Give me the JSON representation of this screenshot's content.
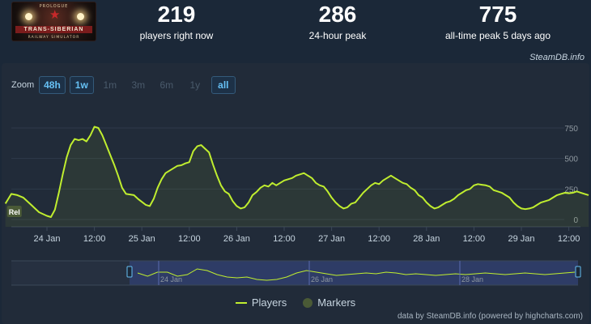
{
  "game": {
    "thumb_small": "PROLOGUE",
    "thumb_title": "TRANS-SIBERIAN",
    "thumb_sub": "RAILWAY SIMULATOR"
  },
  "stats": [
    {
      "value": "219",
      "label": "players right now"
    },
    {
      "value": "286",
      "label": "24-hour peak"
    },
    {
      "value": "775",
      "label": "all-time peak 5 days ago"
    }
  ],
  "credit_top": "SteamDB.info",
  "zoom": {
    "label": "Zoom",
    "buttons": [
      {
        "label": "48h",
        "state": "active"
      },
      {
        "label": "1w",
        "state": "active"
      },
      {
        "label": "1m",
        "state": "dim"
      },
      {
        "label": "3m",
        "state": "dim"
      },
      {
        "label": "6m",
        "state": "dim"
      },
      {
        "label": "1y",
        "state": "dim"
      },
      {
        "label": "all",
        "state": "active"
      }
    ]
  },
  "legend": {
    "players": "Players",
    "markers": "Markers"
  },
  "credit_bottom": "data by SteamDB.info (powered by highcharts.com)",
  "colors": {
    "line": "#c0ee2f",
    "marker": "#4a5a36",
    "navigator_fill": "#3a4a8c"
  },
  "chart_data": {
    "type": "line",
    "title": "",
    "xlabel": "",
    "ylabel": "",
    "x_tick_labels": [
      "24 Jan",
      "12:00",
      "25 Jan",
      "12:00",
      "26 Jan",
      "12:00",
      "27 Jan",
      "12:00",
      "28 Jan",
      "12:00",
      "29 Jan",
      "12:00"
    ],
    "y_ticks": [
      0,
      250,
      500,
      750
    ],
    "ylim": [
      -40,
      850
    ],
    "grid": true,
    "legend_position": "bottom-center",
    "marker_label": "Rel",
    "x_unit": "hours since first tick (24 Jan 00:00)",
    "x_min": -10.5,
    "x_max": 155,
    "series": [
      {
        "name": "Players",
        "points": [
          [
            -10.5,
            130
          ],
          [
            -9,
            210
          ],
          [
            -7.5,
            200
          ],
          [
            -6,
            180
          ],
          [
            -4,
            120
          ],
          [
            -2,
            60
          ],
          [
            0,
            30
          ],
          [
            1,
            20
          ],
          [
            2,
            80
          ],
          [
            3,
            220
          ],
          [
            4,
            370
          ],
          [
            5,
            510
          ],
          [
            6,
            610
          ],
          [
            7,
            660
          ],
          [
            8,
            650
          ],
          [
            9,
            660
          ],
          [
            10,
            640
          ],
          [
            11,
            690
          ],
          [
            12,
            760
          ],
          [
            13,
            750
          ],
          [
            14,
            690
          ],
          [
            15,
            610
          ],
          [
            16,
            530
          ],
          [
            17,
            450
          ],
          [
            18,
            360
          ],
          [
            19,
            260
          ],
          [
            20,
            210
          ],
          [
            21,
            205
          ],
          [
            22,
            200
          ],
          [
            23,
            170
          ],
          [
            24,
            145
          ],
          [
            25,
            120
          ],
          [
            26,
            110
          ],
          [
            27,
            170
          ],
          [
            28,
            260
          ],
          [
            29,
            330
          ],
          [
            30,
            380
          ],
          [
            31,
            400
          ],
          [
            32,
            420
          ],
          [
            33,
            440
          ],
          [
            34,
            445
          ],
          [
            35,
            460
          ],
          [
            36,
            470
          ],
          [
            37,
            560
          ],
          [
            38,
            600
          ],
          [
            39,
            610
          ],
          [
            40,
            580
          ],
          [
            41,
            550
          ],
          [
            42,
            450
          ],
          [
            43,
            360
          ],
          [
            44,
            280
          ],
          [
            45,
            230
          ],
          [
            46,
            210
          ],
          [
            47,
            150
          ],
          [
            48,
            110
          ],
          [
            49,
            90
          ],
          [
            50,
            100
          ],
          [
            51,
            140
          ],
          [
            52,
            200
          ],
          [
            53,
            225
          ],
          [
            54,
            260
          ],
          [
            55,
            280
          ],
          [
            56,
            270
          ],
          [
            57,
            300
          ],
          [
            58,
            280
          ],
          [
            59,
            300
          ],
          [
            60,
            320
          ],
          [
            61,
            330
          ],
          [
            62,
            340
          ],
          [
            63,
            360
          ],
          [
            64,
            370
          ],
          [
            65,
            380
          ],
          [
            66,
            360
          ],
          [
            67,
            340
          ],
          [
            68,
            300
          ],
          [
            69,
            280
          ],
          [
            70,
            270
          ],
          [
            71,
            230
          ],
          [
            72,
            180
          ],
          [
            73,
            140
          ],
          [
            74,
            110
          ],
          [
            75,
            90
          ],
          [
            76,
            100
          ],
          [
            77,
            130
          ],
          [
            78,
            140
          ],
          [
            79,
            180
          ],
          [
            80,
            220
          ],
          [
            81,
            250
          ],
          [
            82,
            280
          ],
          [
            83,
            300
          ],
          [
            84,
            290
          ],
          [
            85,
            320
          ],
          [
            86,
            340
          ],
          [
            87,
            360
          ],
          [
            88,
            340
          ],
          [
            89,
            320
          ],
          [
            90,
            300
          ],
          [
            91,
            290
          ],
          [
            92,
            260
          ],
          [
            93,
            240
          ],
          [
            94,
            200
          ],
          [
            95,
            180
          ],
          [
            96,
            140
          ],
          [
            97,
            110
          ],
          [
            98,
            90
          ],
          [
            99,
            100
          ],
          [
            100,
            120
          ],
          [
            101,
            140
          ],
          [
            102,
            150
          ],
          [
            103,
            170
          ],
          [
            104,
            200
          ],
          [
            105,
            220
          ],
          [
            106,
            240
          ],
          [
            107,
            250
          ],
          [
            108,
            280
          ],
          [
            109,
            290
          ],
          [
            110,
            285
          ],
          [
            111,
            280
          ],
          [
            112,
            270
          ],
          [
            113,
            240
          ],
          [
            114,
            230
          ],
          [
            115,
            220
          ],
          [
            116,
            200
          ],
          [
            117,
            180
          ],
          [
            118,
            140
          ],
          [
            119,
            110
          ],
          [
            120,
            90
          ],
          [
            121,
            85
          ],
          [
            122,
            90
          ],
          [
            123,
            100
          ],
          [
            124,
            120
          ],
          [
            125,
            140
          ],
          [
            126,
            150
          ],
          [
            127,
            160
          ],
          [
            128,
            180
          ],
          [
            129,
            200
          ],
          [
            130,
            210
          ],
          [
            131,
            219
          ],
          [
            132,
            215
          ],
          [
            133,
            219
          ],
          [
            134,
            230
          ],
          [
            135,
            220
          ],
          [
            136,
            210
          ],
          [
            137,
            200
          ]
        ]
      }
    ],
    "navigator": {
      "points": [
        [
          0,
          0.55
        ],
        [
          4,
          0.35
        ],
        [
          8,
          0.6
        ],
        [
          12,
          0.6
        ],
        [
          16,
          0.35
        ],
        [
          20,
          0.45
        ],
        [
          24,
          0.8
        ],
        [
          28,
          0.7
        ],
        [
          32,
          0.45
        ],
        [
          36,
          0.3
        ],
        [
          40,
          0.25
        ],
        [
          44,
          0.3
        ],
        [
          48,
          0.15
        ],
        [
          52,
          0.1
        ],
        [
          56,
          0.15
        ],
        [
          60,
          0.3
        ],
        [
          64,
          0.55
        ],
        [
          68,
          0.7
        ],
        [
          72,
          0.6
        ],
        [
          76,
          0.5
        ],
        [
          80,
          0.4
        ],
        [
          84,
          0.45
        ],
        [
          88,
          0.5
        ],
        [
          92,
          0.55
        ],
        [
          96,
          0.5
        ],
        [
          100,
          0.6
        ],
        [
          104,
          0.55
        ],
        [
          108,
          0.45
        ],
        [
          112,
          0.5
        ],
        [
          116,
          0.45
        ],
        [
          120,
          0.4
        ],
        [
          124,
          0.45
        ],
        [
          128,
          0.5
        ],
        [
          132,
          0.45
        ],
        [
          136,
          0.5
        ],
        [
          140,
          0.55
        ],
        [
          144,
          0.5
        ],
        [
          148,
          0.45
        ],
        [
          152,
          0.5
        ],
        [
          156,
          0.55
        ],
        [
          160,
          0.5
        ],
        [
          164,
          0.45
        ],
        [
          168,
          0.5
        ],
        [
          172,
          0.55
        ],
        [
          176,
          0.6
        ]
      ],
      "labels": [
        "24 Jan",
        "26 Jan",
        "28 Jan"
      ]
    }
  }
}
